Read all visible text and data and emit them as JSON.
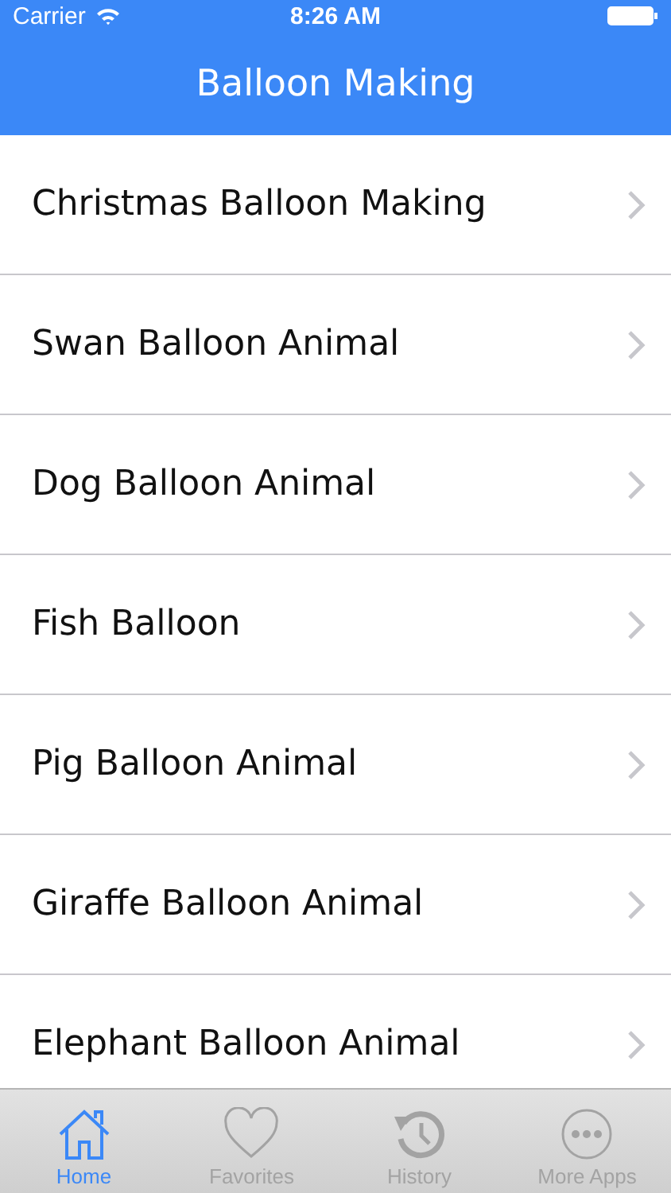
{
  "status_bar": {
    "carrier": "Carrier",
    "time": "8:26 AM"
  },
  "navigation_bar": {
    "title": "Balloon Making"
  },
  "items": [
    {
      "label": "Christmas Balloon Making"
    },
    {
      "label": "Swan Balloon Animal"
    },
    {
      "label": "Dog Balloon Animal"
    },
    {
      "label": "Fish Balloon"
    },
    {
      "label": "Pig Balloon Animal"
    },
    {
      "label": "Giraffe Balloon Animal"
    },
    {
      "label": "Elephant Balloon Animal"
    }
  ],
  "tabs": [
    {
      "label": "Home",
      "kind": "home",
      "selected": true
    },
    {
      "label": "Favorites",
      "kind": "favorites",
      "selected": false
    },
    {
      "label": "History",
      "kind": "history",
      "selected": false
    },
    {
      "label": "More Apps",
      "kind": "more",
      "selected": false
    }
  ]
}
